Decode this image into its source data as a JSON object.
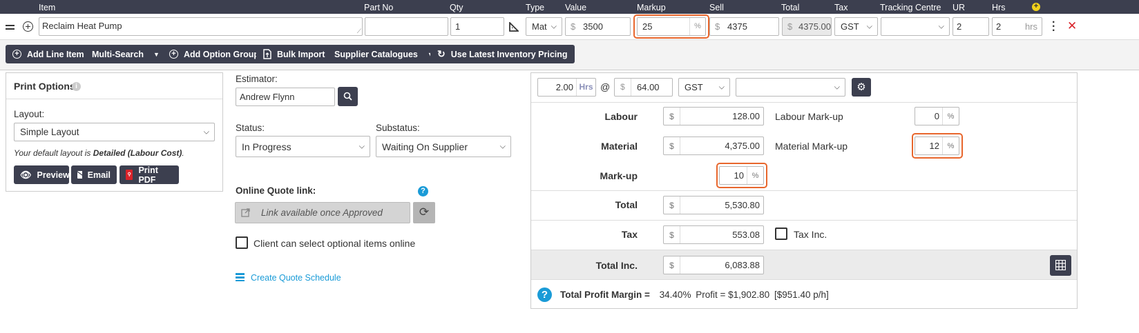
{
  "header": {
    "columns": {
      "item": "Item",
      "part_no": "Part No",
      "qty": "Qty",
      "type": "Type",
      "value": "Value",
      "markup": "Markup",
      "sell": "Sell",
      "total": "Total",
      "tax": "Tax",
      "tracking": "Tracking Centre",
      "ur": "UR",
      "hrs": "Hrs"
    }
  },
  "line_item": {
    "item": "Reclaim Heat Pump",
    "part_no": "",
    "qty": "1",
    "type": "Mat",
    "value_currency": "$",
    "value": "3500",
    "markup": "25",
    "markup_unit": "%",
    "sell_currency": "$",
    "sell": "4375",
    "total_currency": "$",
    "total": "4375.00",
    "tax": "GST",
    "tracking": "",
    "ur": "2",
    "hrs": "2",
    "hrs_unit": "hrs"
  },
  "toolbar": {
    "add_line_item": "Add Line Item",
    "multi_search": "Multi-Search",
    "add_option_group": "Add Option Group",
    "bulk_import": "Bulk Import",
    "supplier_catalogues": "Supplier Catalogues",
    "use_latest_pricing": "Use Latest Inventory Pricing"
  },
  "print_options": {
    "title": "Print Options",
    "layout_label": "Layout:",
    "layout_value": "Simple Layout",
    "default_note_prefix": "Your default layout is ",
    "default_note_bold": "Detailed (Labour Cost)",
    "default_note_suffix": ".",
    "preview": "Preview",
    "email": "Email",
    "print_pdf": "Print PDF"
  },
  "estimator": {
    "label": "Estimator:",
    "value": "Andrew Flynn"
  },
  "status": {
    "label": "Status:",
    "value": "In Progress",
    "substatus_label": "Substatus:",
    "substatus_value": "Waiting On Supplier"
  },
  "online_quote": {
    "label": "Online Quote link:",
    "link_text": "Link available once Approved",
    "client_optional_label": "Client can select optional items online",
    "create_schedule": "Create Quote Schedule"
  },
  "summary": {
    "hours": "2.00",
    "hours_unit": "Hrs",
    "at": "@",
    "rate_currency": "$",
    "rate": "64.00",
    "tax": "GST",
    "tracking": "",
    "labour_label": "Labour",
    "labour": "128.00",
    "labour_markup_label": "Labour Mark-up",
    "labour_markup": "0",
    "material_label": "Material",
    "material": "4,375.00",
    "material_markup_label": "Material Mark-up",
    "material_markup": "12",
    "markup_label": "Mark-up",
    "markup": "10",
    "total_label": "Total",
    "total": "5,530.80",
    "tax_label": "Tax",
    "tax_value": "553.08",
    "tax_inc_label": "Tax Inc.",
    "total_inc_label": "Total Inc.",
    "total_inc": "6,083.88",
    "currency": "$",
    "pct": "%",
    "profit_margin_label": "Total Profit Margin =",
    "profit_margin": "34.40%",
    "profit": "Profit = $1,902.80",
    "per_hour": "[$951.40 p/h]"
  },
  "colors": {
    "dark": "#3c3f4f",
    "highlight": "#e8662c",
    "link": "#1a9bd7",
    "add_icon": "#f2d21b"
  }
}
